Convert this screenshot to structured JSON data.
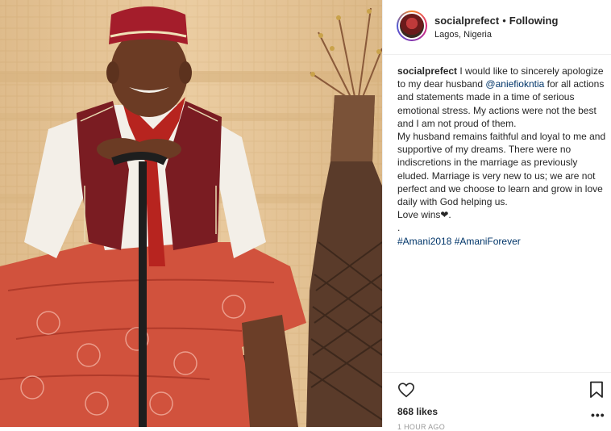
{
  "post": {
    "photo_alt": "Man in red hat and red embroidered wrapper sitting with a cane"
  },
  "header": {
    "username": "socialprefect",
    "separator": "•",
    "follow_label": "Following",
    "location": "Lagos, Nigeria"
  },
  "caption": {
    "username": "socialprefect",
    "text_part1": "I would like to sincerely apologize to my dear husband",
    "mention": "@aniefiokntia",
    "text_part2": "for all actions and statements made in a time of serious emotional stress. My actions were not the best and I am not proud of them.",
    "text_part3": "My husband remains faithful and loyal to me and supportive of my dreams. There were no indiscretions in the marriage as previously eluded. Marriage is very new to us; we are not perfect and we choose to learn and grow in love daily with God helping us.",
    "text_part4": "Love wins❤.",
    "dot_line": ".",
    "hashtag1": "#Amani2018",
    "hashtag2": "#AmaniForever"
  },
  "actions": {
    "heart_icon": "heart-icon",
    "bookmark_icon": "bookmark-icon",
    "likes": "868 likes",
    "more": "•••",
    "timestamp": "1 HOUR AGO"
  },
  "colors": {
    "link": "#003569",
    "text": "#262626",
    "border": "#efefef"
  }
}
